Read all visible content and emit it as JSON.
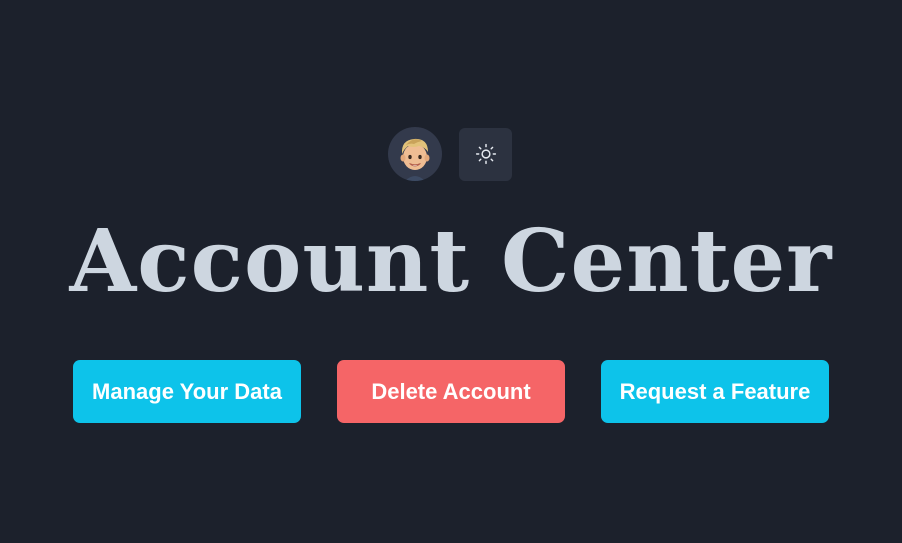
{
  "header": {
    "avatar_icon": "memoji-avatar-icon",
    "theme_toggle_icon": "sun-icon"
  },
  "page": {
    "title": "Account Center"
  },
  "actions": {
    "manage_data_label": "Manage Your Data",
    "delete_account_label": "Delete Account",
    "request_feature_label": "Request a Feature"
  },
  "colors": {
    "background": "#1c212c",
    "primary": "#0dc3ea",
    "danger": "#f56567",
    "title": "#cdd6e0"
  }
}
